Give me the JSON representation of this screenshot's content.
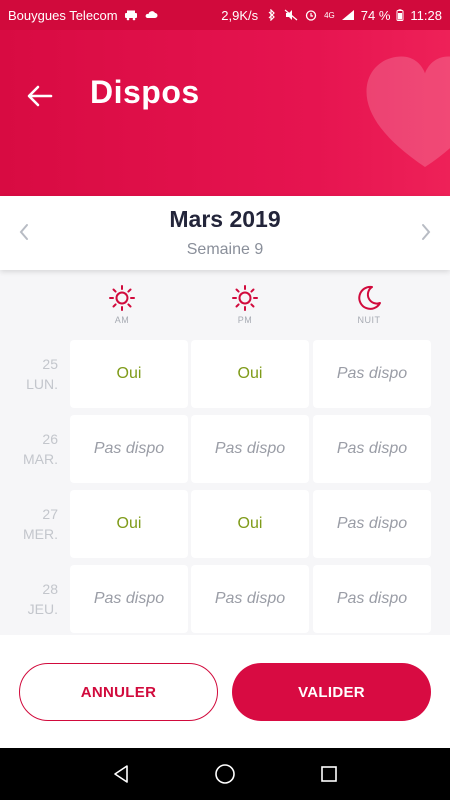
{
  "status_bar": {
    "carrier": "Bouygues Telecom",
    "speed": "2,9K/s",
    "network": "4G",
    "battery": "74 %",
    "time": "11:28"
  },
  "header": {
    "title": "Dispos"
  },
  "week": {
    "month": "Mars 2019",
    "week_label": "Semaine 9"
  },
  "slots": [
    {
      "label": "AM",
      "icon": "sun-icon"
    },
    {
      "label": "PM",
      "icon": "sun-icon"
    },
    {
      "label": "NUIT",
      "icon": "moon-icon"
    }
  ],
  "days": [
    {
      "num": "25",
      "name": "LUN.",
      "values": [
        "Oui",
        "Oui",
        "Pas dispo"
      ]
    },
    {
      "num": "26",
      "name": "MAR.",
      "values": [
        "Pas dispo",
        "Pas dispo",
        "Pas dispo"
      ]
    },
    {
      "num": "27",
      "name": "MER.",
      "values": [
        "Oui",
        "Oui",
        "Pas dispo"
      ]
    },
    {
      "num": "28",
      "name": "JEU.",
      "values": [
        "Pas dispo",
        "Pas dispo",
        "Pas dispo"
      ]
    }
  ],
  "buttons": {
    "cancel": "ANNULER",
    "validate": "VALIDER"
  },
  "colors": {
    "brand": "#d80b42",
    "yes": "#7f9b19",
    "no": "#9a9da6"
  }
}
